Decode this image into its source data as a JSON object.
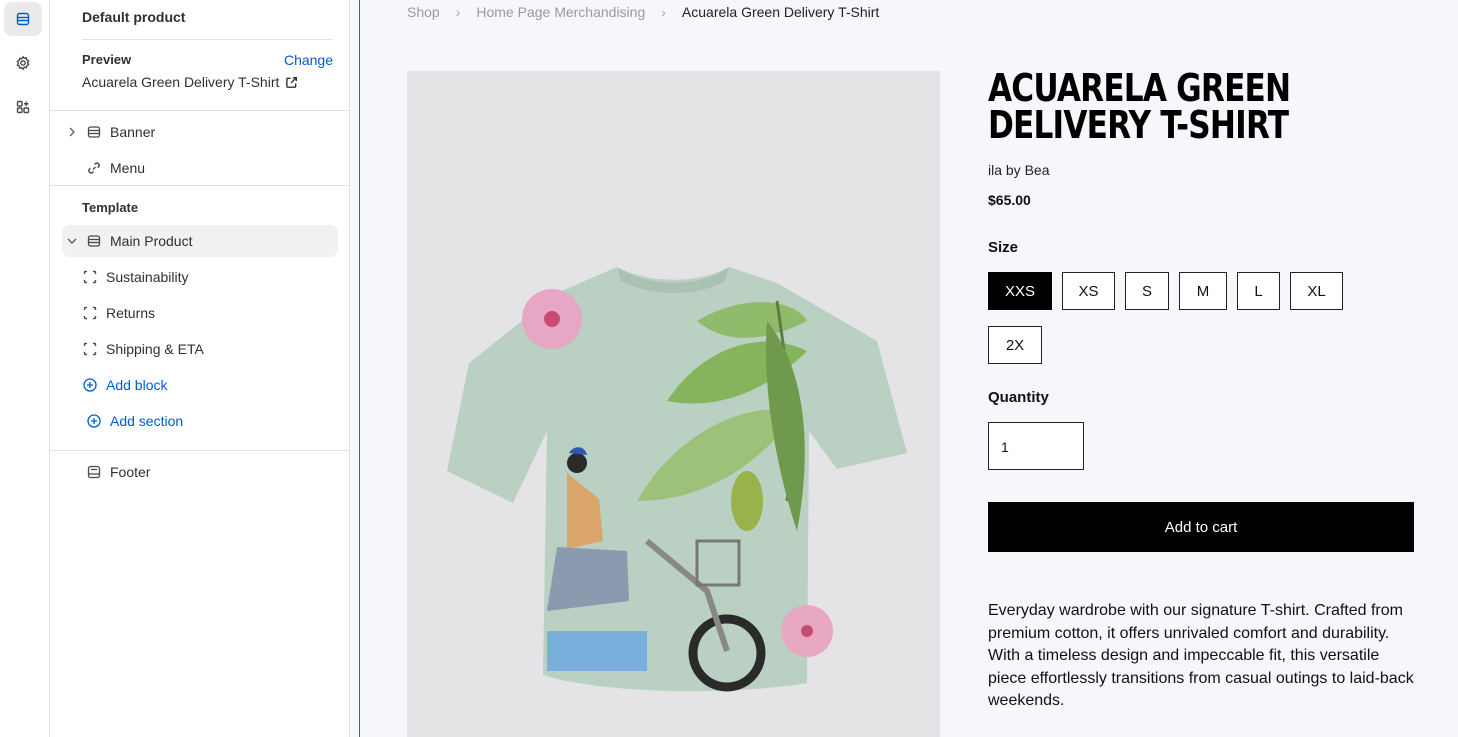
{
  "rail": {
    "items": [
      {
        "name": "sections-icon"
      },
      {
        "name": "settings-icon"
      },
      {
        "name": "apps-icon"
      }
    ]
  },
  "sidebar": {
    "title": "Default product",
    "preview_label": "Preview",
    "change_label": "Change",
    "preview_value": "Acuarela Green Delivery T-Shirt",
    "header_items": [
      {
        "label": "Banner"
      },
      {
        "label": "Menu"
      }
    ],
    "template_label": "Template",
    "main_section": "Main Product",
    "blocks": [
      {
        "label": "Sustainability"
      },
      {
        "label": "Returns"
      },
      {
        "label": "Shipping & ETA"
      }
    ],
    "add_block": "Add block",
    "add_section": "Add section",
    "footer": "Footer"
  },
  "page": {
    "breadcrumb": [
      "Shop",
      "Home Page Merchandising",
      "Acuarela Green Delivery T-Shirt"
    ],
    "breadcrumb_sep": "›",
    "title": "Acuarela Green Delivery T-Shirt",
    "vendor": "ila by Bea",
    "price": "$65.00",
    "size_label": "Size",
    "sizes": [
      "XXS",
      "XS",
      "S",
      "M",
      "L",
      "XL",
      "2X"
    ],
    "selected_size": "XXS",
    "quantity_label": "Quantity",
    "quantity": "1",
    "add_to_cart": "Add to cart",
    "description": "Everyday wardrobe with our signature T-shirt. Crafted from premium cotton, it offers unrivaled comfort and durability. With a timeless design and impeccable fit, this versatile piece effortlessly transitions from casual outings to laid-back weekends."
  },
  "colors": {
    "accent": "#005bd3",
    "selected_border": "#3b5ab8",
    "button": "#000000"
  }
}
